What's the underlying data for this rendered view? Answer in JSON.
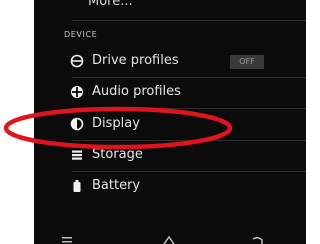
{
  "top": {
    "more_label": "More..."
  },
  "device_section": {
    "header": "DEVICE",
    "items": [
      {
        "label": "Drive profiles",
        "icon": "drive-profiles-icon",
        "toggle": "OFF"
      },
      {
        "label": "Audio profiles",
        "icon": "audio-profiles-icon"
      },
      {
        "label": "Display",
        "icon": "display-icon"
      },
      {
        "label": "Storage",
        "icon": "storage-icon"
      },
      {
        "label": "Battery",
        "icon": "battery-icon"
      }
    ]
  },
  "nav_bar": {
    "icons": [
      "recent-apps-icon",
      "home-icon",
      "back-icon"
    ]
  },
  "colors": {
    "background": "#0b0b0b",
    "text": "#e6e6e6",
    "highlight": "#e0141e",
    "toggle_bg": "#3a3a3a"
  }
}
